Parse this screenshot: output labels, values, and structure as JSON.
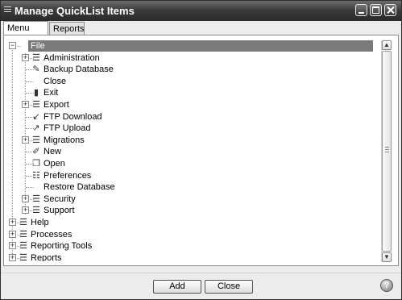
{
  "window": {
    "title": "Manage QuickList Items"
  },
  "tabs": [
    {
      "label": "Menu Items",
      "active": true
    },
    {
      "label": "Reports",
      "active": false
    }
  ],
  "tree": [
    {
      "label": "File",
      "level": 0,
      "expander": "minus",
      "icon": "menu-icon",
      "glyph": "☰",
      "selected": true
    },
    {
      "label": "Administration",
      "level": 1,
      "expander": "plus",
      "icon": "menu-icon",
      "glyph": "☰"
    },
    {
      "label": "Backup Database",
      "level": 1,
      "expander": "",
      "icon": "backup-icon",
      "glyph": "✎"
    },
    {
      "label": "Close",
      "level": 1,
      "expander": "",
      "icon": "",
      "glyph": ""
    },
    {
      "label": "Exit",
      "level": 1,
      "expander": "",
      "icon": "exit-icon",
      "glyph": "▮"
    },
    {
      "label": "Export",
      "level": 1,
      "expander": "plus",
      "icon": "menu-icon",
      "glyph": "☰"
    },
    {
      "label": "FTP Download",
      "level": 1,
      "expander": "",
      "icon": "download-icon",
      "glyph": "↙"
    },
    {
      "label": "FTP Upload",
      "level": 1,
      "expander": "",
      "icon": "upload-icon",
      "glyph": "↗"
    },
    {
      "label": "Migrations",
      "level": 1,
      "expander": "plus",
      "icon": "menu-icon",
      "glyph": "☰"
    },
    {
      "label": "New",
      "level": 1,
      "expander": "",
      "icon": "new-icon",
      "glyph": "✐"
    },
    {
      "label": "Open",
      "level": 1,
      "expander": "",
      "icon": "open-icon",
      "glyph": "❐"
    },
    {
      "label": "Preferences",
      "level": 1,
      "expander": "",
      "icon": "preferences-icon",
      "glyph": "☷"
    },
    {
      "label": "Restore Database",
      "level": 1,
      "expander": "",
      "icon": "",
      "glyph": ""
    },
    {
      "label": "Security",
      "level": 1,
      "expander": "plus",
      "icon": "menu-icon",
      "glyph": "☰"
    },
    {
      "label": "Support",
      "level": 1,
      "expander": "plus",
      "icon": "menu-icon",
      "glyph": "☰"
    },
    {
      "label": "Help",
      "level": 0,
      "expander": "plus",
      "icon": "menu-icon",
      "glyph": "☰"
    },
    {
      "label": "Processes",
      "level": 0,
      "expander": "plus",
      "icon": "menu-icon",
      "glyph": "☰"
    },
    {
      "label": "Reporting Tools",
      "level": 0,
      "expander": "plus",
      "icon": "menu-icon",
      "glyph": "☰"
    },
    {
      "label": "Reports",
      "level": 0,
      "expander": "plus",
      "icon": "menu-icon",
      "glyph": "☰"
    }
  ],
  "buttons": {
    "add": "Add",
    "close": "Close"
  },
  "icons": {
    "window_menu": "window-menu-icon",
    "minimize": "minimize-icon",
    "maximize": "maximize-icon",
    "close": "close-icon",
    "help": "help-icon",
    "help_glyph": "?"
  },
  "scrollbar": {
    "up_glyph": "▲",
    "down_glyph": "▼"
  },
  "colors": {
    "titlebar": "#3c3c3c",
    "selection": "#7a7a7a"
  }
}
